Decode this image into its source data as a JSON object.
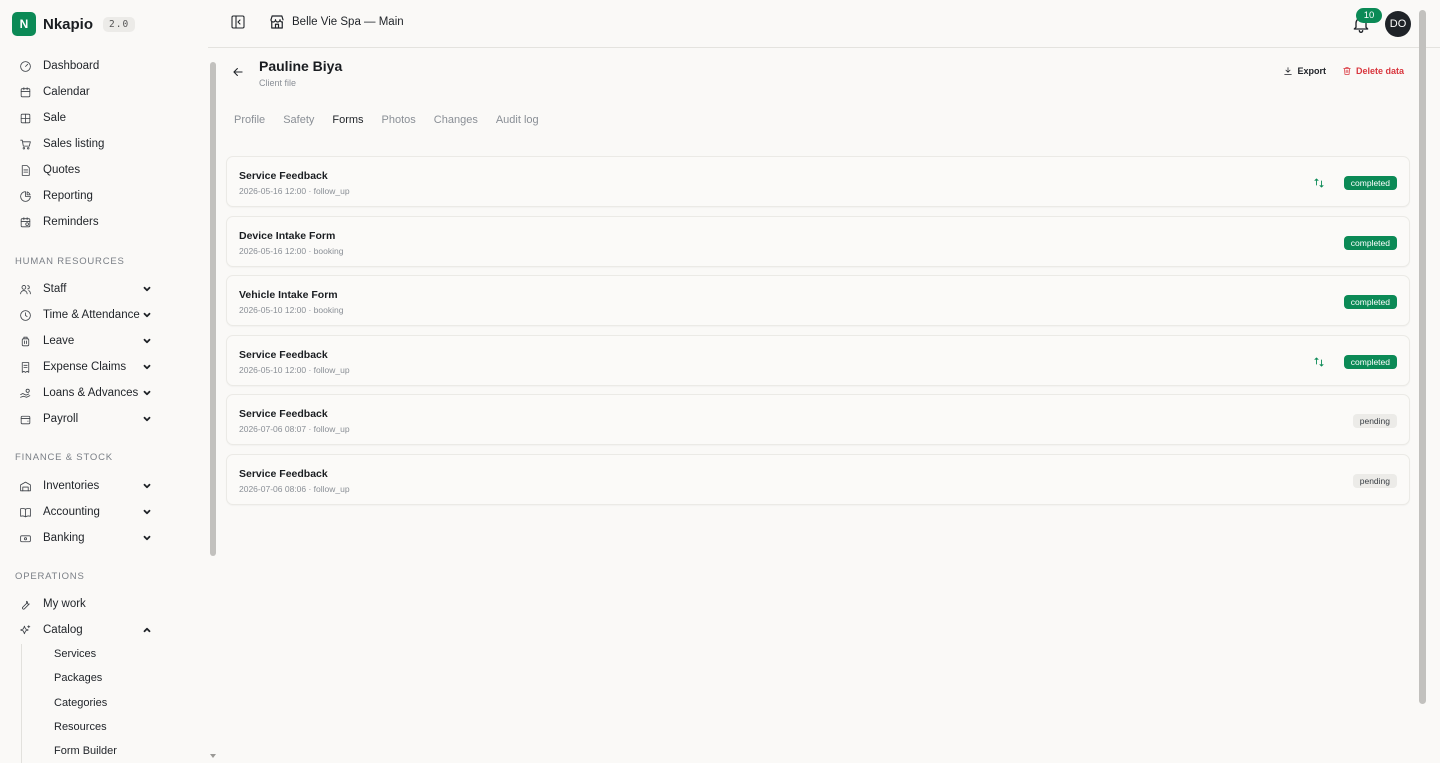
{
  "brand": {
    "logo_letter": "N",
    "name": "Nkapio",
    "version": "2.0"
  },
  "sidebar": {
    "main_items": [
      {
        "label": "Dashboard",
        "icon": "gauge-icon"
      },
      {
        "label": "Calendar",
        "icon": "calendar-icon"
      },
      {
        "label": "Sale",
        "icon": "grid-icon"
      },
      {
        "label": "Sales listing",
        "icon": "cart-icon"
      },
      {
        "label": "Quotes",
        "icon": "document-icon"
      },
      {
        "label": "Reporting",
        "icon": "pie-chart-icon"
      },
      {
        "label": "Reminders",
        "icon": "calendar-clock-icon"
      }
    ],
    "sections": [
      {
        "title": "HUMAN RESOURCES",
        "items": [
          {
            "label": "Staff",
            "icon": "users-icon"
          },
          {
            "label": "Time & Attendance",
            "icon": "clock-icon"
          },
          {
            "label": "Leave",
            "icon": "luggage-icon"
          },
          {
            "label": "Expense Claims",
            "icon": "receipt-icon"
          },
          {
            "label": "Loans & Advances",
            "icon": "hand-coins-icon"
          },
          {
            "label": "Payroll",
            "icon": "wallet-icon"
          }
        ]
      },
      {
        "title": "FINANCE & STOCK",
        "items": [
          {
            "label": "Inventories",
            "icon": "warehouse-icon"
          },
          {
            "label": "Accounting",
            "icon": "book-icon"
          },
          {
            "label": "Banking",
            "icon": "banknote-icon"
          }
        ]
      },
      {
        "title": "OPERATIONS",
        "items": [
          {
            "label": "My work",
            "icon": "wrench-icon"
          },
          {
            "label": "Catalog",
            "icon": "sparkles-icon"
          }
        ]
      }
    ],
    "catalog_sub": [
      "Services",
      "Packages",
      "Categories",
      "Resources",
      "Form Builder"
    ]
  },
  "topbar": {
    "store_name": "Belle Vie Spa — Main",
    "notifications": "10",
    "avatar_initials": "DO"
  },
  "client": {
    "name": "Pauline Biya",
    "subtitle": "Client file"
  },
  "actions": {
    "export": "Export",
    "delete": "Delete data"
  },
  "tabs": [
    "Profile",
    "Safety",
    "Forms",
    "Photos",
    "Changes",
    "Audit log"
  ],
  "active_tab": "Forms",
  "forms": [
    {
      "title": "Service Feedback",
      "meta": "2026-05-16 12:00 · follow_up",
      "status": "completed",
      "synced": true
    },
    {
      "title": "Device Intake Form",
      "meta": "2026-05-16 12:00 · booking",
      "status": "completed",
      "synced": false
    },
    {
      "title": "Vehicle Intake Form",
      "meta": "2026-05-10 12:00 · booking",
      "status": "completed",
      "synced": false
    },
    {
      "title": "Service Feedback",
      "meta": "2026-05-10 12:00 · follow_up",
      "status": "completed",
      "synced": true
    },
    {
      "title": "Service Feedback",
      "meta": "2026-07-06 08:07 · follow_up",
      "status": "pending",
      "synced": false
    },
    {
      "title": "Service Feedback",
      "meta": "2026-07-06 08:06 · follow_up",
      "status": "pending",
      "synced": false
    }
  ],
  "colors": {
    "accent": "#0b8a56",
    "danger": "#d9363e"
  }
}
